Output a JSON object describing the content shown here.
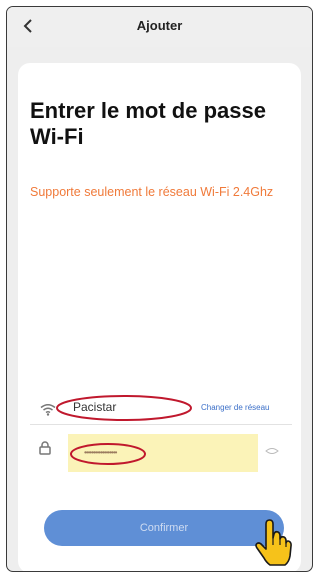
{
  "header": {
    "title": "Ajouter",
    "back_icon": "back-chevron-icon"
  },
  "content": {
    "heading": "Entrer le mot de passe Wi-Fi",
    "note": "Supporte seulement le réseau Wi-Fi 2.4Ghz"
  },
  "network": {
    "wifi_icon": "wifi-icon",
    "ssid": "Pacistar",
    "change_label": "Changer de réseau"
  },
  "password": {
    "lock_icon": "lock-icon",
    "value": "••••••••••••••••••",
    "eye_icon": "eye-icon"
  },
  "actions": {
    "confirm_label": "Confirmer"
  },
  "colors": {
    "accent": "#5f8fd6",
    "note": "#f07a3a",
    "highlight": "#fbf3b8",
    "annotation": "#c0182d"
  },
  "annotation_icons": [
    "hand-pointer-icon"
  ]
}
